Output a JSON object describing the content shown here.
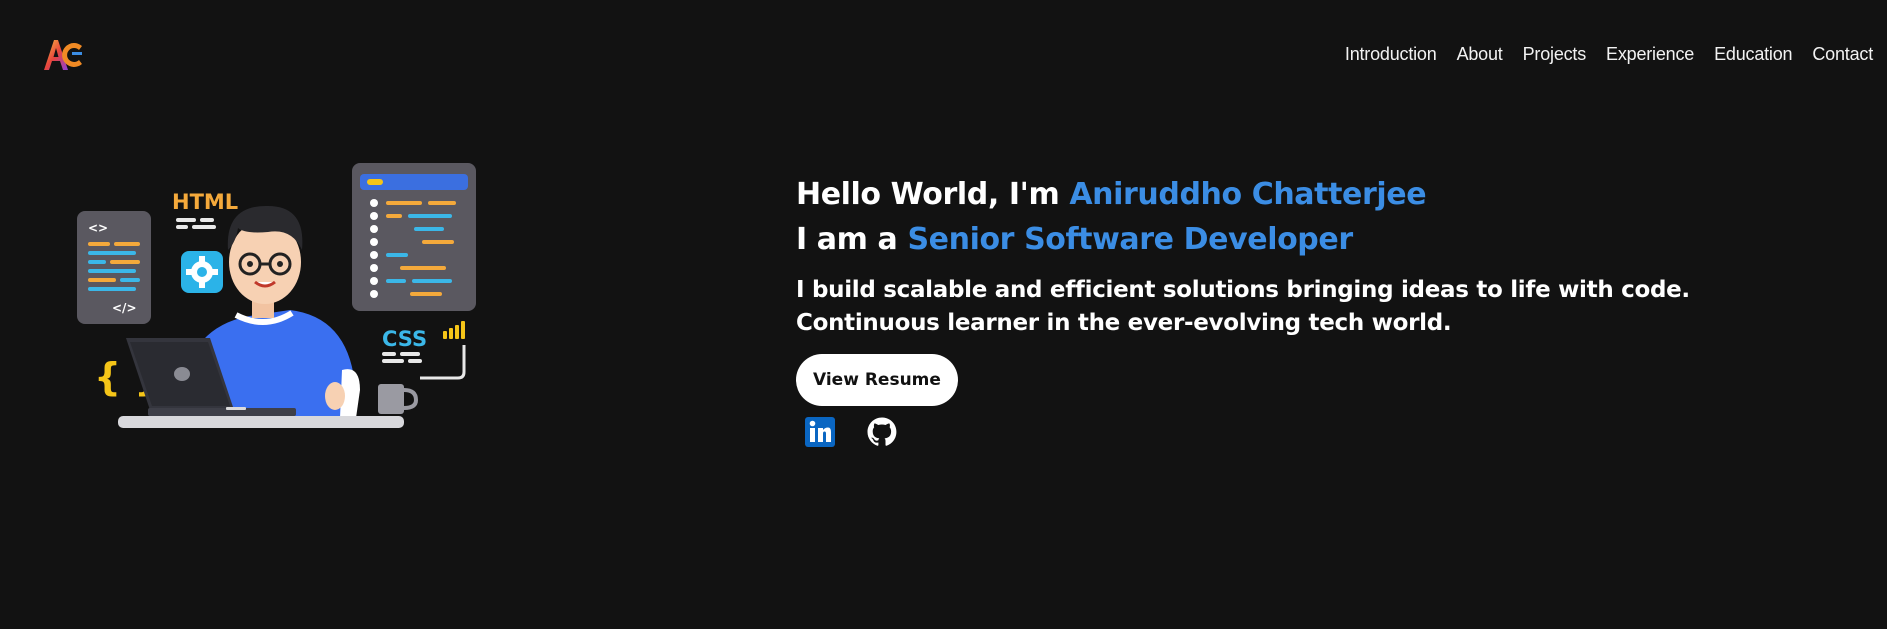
{
  "brand": {
    "logo_text": "AC"
  },
  "nav": {
    "items": [
      {
        "label": "Introduction"
      },
      {
        "label": "About"
      },
      {
        "label": "Projects"
      },
      {
        "label": "Experience"
      },
      {
        "label": "Education"
      },
      {
        "label": "Contact"
      }
    ]
  },
  "illustration": {
    "html_label": "HTML",
    "css_label": "CSS",
    "code_open_tag": "<>",
    "code_close_tag": "</>",
    "braces": "{ }"
  },
  "hero": {
    "greeting_prefix": "Hello World, I'm ",
    "name": "Aniruddho Chatterjee",
    "role_prefix": "I am a ",
    "role": "Senior Software Developer",
    "tagline_line1": "I build scalable and efficient solutions bringing ideas to life with code.",
    "tagline_line2": "Continuous learner in the ever-evolving tech world.",
    "resume_button": "View Resume"
  },
  "socials": [
    {
      "icon": "linkedin-icon"
    },
    {
      "icon": "github-icon"
    }
  ],
  "colors": {
    "background": "#121212",
    "accent": "#3b8de4",
    "text": "#ffffff"
  }
}
